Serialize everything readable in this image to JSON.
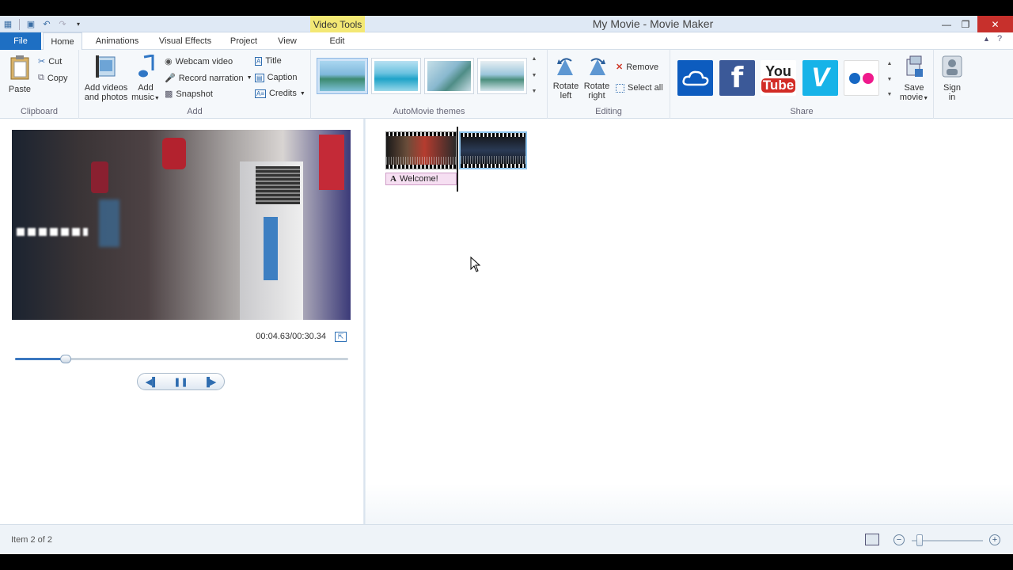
{
  "window": {
    "title": "My Movie - Movie Maker",
    "contextual_tab": "Video Tools",
    "controls": {
      "minimize": "—",
      "restore": "❐",
      "close": "✕"
    }
  },
  "tabs": {
    "file": "File",
    "home": "Home",
    "animations": "Animations",
    "visual_effects": "Visual Effects",
    "project": "Project",
    "view": "View",
    "edit": "Edit"
  },
  "ribbon": {
    "clipboard": {
      "label": "Clipboard",
      "paste": "Paste",
      "cut": "Cut",
      "copy": "Copy"
    },
    "add": {
      "label": "Add",
      "add_videos_line1": "Add videos",
      "add_videos_line2": "and photos",
      "add_music_line1": "Add",
      "add_music_line2": "music",
      "webcam": "Webcam video",
      "record": "Record narration",
      "snapshot": "Snapshot",
      "title": "Title",
      "caption": "Caption",
      "credits": "Credits"
    },
    "themes": {
      "label": "AutoMovie themes"
    },
    "editing": {
      "label": "Editing",
      "rotate_left_1": "Rotate",
      "rotate_left_2": "left",
      "rotate_right_1": "Rotate",
      "rotate_right_2": "right",
      "remove": "Remove",
      "select_all": "Select all"
    },
    "share": {
      "label": "Share",
      "save_movie_1": "Save",
      "save_movie_2": "movie",
      "sign_in_1": "Sign",
      "sign_in_2": "in",
      "youtube_1": "You",
      "youtube_2": "Tube",
      "facebook": "f",
      "vimeo": "V"
    }
  },
  "preview": {
    "timecode": "00:04.63/00:30.34",
    "progress": 0.153,
    "fullscreen_icon": "⇱"
  },
  "storyboard": {
    "caption_text": "Welcome!",
    "caption_glyph": "A"
  },
  "status": {
    "item_text": "Item 2 of 2"
  },
  "colors": {
    "file_tab": "#1e6fc3",
    "contextual": "#f3e874",
    "facebook": "#3b5998",
    "youtube": "#d22c26",
    "vimeo": "#17b3e8",
    "onedrive": "#0d5cbf"
  }
}
